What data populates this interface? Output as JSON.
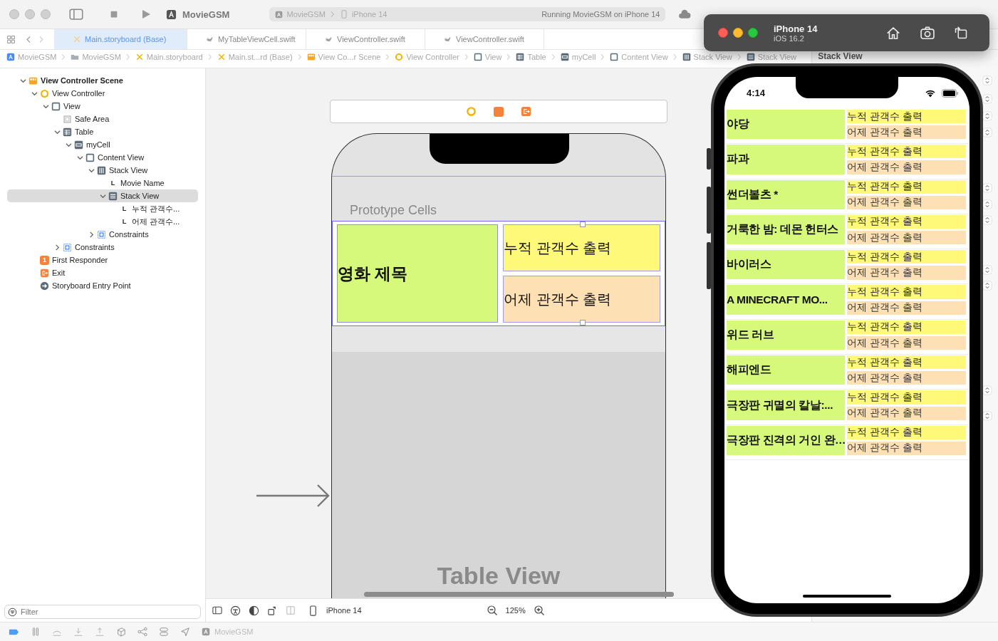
{
  "toolbar": {
    "app": "MovieGSM",
    "scheme": "MovieGSM",
    "device": "iPhone 14",
    "status": "Running MovieGSM on iPhone 14"
  },
  "tabs": [
    {
      "label": "Main.storyboard (Base)",
      "kind": "storyboard",
      "selected": true
    },
    {
      "label": "MyTableViewCell.swift",
      "kind": "swift",
      "selected": false
    },
    {
      "label": "ViewController.swift",
      "kind": "swift",
      "selected": false
    },
    {
      "label": "ViewController.swift",
      "kind": "swift",
      "selected": false
    }
  ],
  "breadcrumb": [
    {
      "label": "MovieGSM",
      "kind": "project"
    },
    {
      "label": "MovieGSM",
      "kind": "folder"
    },
    {
      "label": "Main.storyboard",
      "kind": "storyboard"
    },
    {
      "label": "Main.st...rd (Base)",
      "kind": "storyboard"
    },
    {
      "label": "View Co...r Scene",
      "kind": "scene"
    },
    {
      "label": "View Controller",
      "kind": "controller"
    },
    {
      "label": "View",
      "kind": "view"
    },
    {
      "label": "Table",
      "kind": "table"
    },
    {
      "label": "myCell",
      "kind": "cell"
    },
    {
      "label": "Content View",
      "kind": "view"
    },
    {
      "label": "Stack View",
      "kind": "stack-h"
    },
    {
      "label": "Stack View",
      "kind": "stack-v"
    }
  ],
  "navigator": {
    "filter_placeholder": "Filter",
    "tree": [
      {
        "label": "View Controller Scene",
        "kind": "scene",
        "expanded": true,
        "selected": false,
        "children": [
          {
            "label": "View Controller",
            "kind": "controller",
            "expanded": true,
            "selected": false,
            "children": [
              {
                "label": "View",
                "kind": "view",
                "expanded": true,
                "selected": false,
                "children": [
                  {
                    "label": "Safe Area",
                    "kind": "safe-area",
                    "selected": false
                  },
                  {
                    "label": "Table",
                    "kind": "table",
                    "expanded": true,
                    "selected": false,
                    "children": [
                      {
                        "label": "myCell",
                        "kind": "cell",
                        "expanded": true,
                        "selected": false,
                        "children": [
                          {
                            "label": "Content View",
                            "kind": "view",
                            "expanded": true,
                            "selected": false,
                            "children": [
                              {
                                "label": "Stack View",
                                "kind": "stack-h",
                                "expanded": true,
                                "selected": false,
                                "children": [
                                  {
                                    "label": "Movie Name",
                                    "kind": "label",
                                    "glyph": "L",
                                    "selected": false
                                  },
                                  {
                                    "label": "Stack View",
                                    "kind": "stack-v",
                                    "expanded": true,
                                    "selected": true,
                                    "children": [
                                      {
                                        "label": "누적 관객수...",
                                        "kind": "label",
                                        "glyph": "L",
                                        "selected": false
                                      },
                                      {
                                        "label": "어제 관객수...",
                                        "kind": "label",
                                        "glyph": "L",
                                        "selected": false
                                      }
                                    ]
                                  }
                                ]
                              },
                              {
                                "label": "Constraints",
                                "kind": "constraints",
                                "expanded": false,
                                "selected": false
                              }
                            ]
                          }
                        ]
                      }
                    ]
                  },
                  {
                    "label": "Constraints",
                    "kind": "constraints",
                    "expanded": false,
                    "selected": false
                  }
                ]
              }
            ]
          },
          {
            "label": "First Responder",
            "kind": "responder",
            "glyph": "1",
            "selected": false
          },
          {
            "label": "Exit",
            "kind": "exit",
            "selected": false
          },
          {
            "label": "Storyboard Entry Point",
            "kind": "entry",
            "selected": false
          }
        ]
      }
    ]
  },
  "canvas": {
    "header": "Prototype Cells",
    "cell": {
      "title": "영화 제목",
      "total": "누적 관객수 출력",
      "yesterday": "어제 관객수 출력"
    },
    "table_label": "Table View",
    "device": "iPhone 14",
    "zoom": "125%"
  },
  "debug_bar": {
    "target": "MovieGSM"
  },
  "inspector": {
    "title": "Stack View"
  },
  "simulator": {
    "device": "iPhone 14",
    "os": "iOS 16.2",
    "time": "4:14",
    "rows": [
      {
        "title": "야당",
        "total": "누적 관객수 출력",
        "yesterday": "어제 관객수 출력"
      },
      {
        "title": "파과",
        "total": "누적 관객수 출력",
        "yesterday": "어제 관객수 출력"
      },
      {
        "title": "썬더볼츠 *",
        "total": "누적 관객수 출력",
        "yesterday": "어제 관객수 출력"
      },
      {
        "title": "거룩한 밤: 데몬 헌터스",
        "total": "누적 관객수 출력",
        "yesterday": "어제 관객수 출력"
      },
      {
        "title": "바이러스",
        "total": "누적 관객수 출력",
        "yesterday": "어제 관객수 출력"
      },
      {
        "title": "A MINECRAFT MO...",
        "total": "누적 관객수 출력",
        "yesterday": "어제 관객수 출력"
      },
      {
        "title": "위드 러브",
        "total": "누적 관객수 출력",
        "yesterday": "어제 관객수 출력"
      },
      {
        "title": "해피엔드",
        "total": "누적 관객수 출력",
        "yesterday": "어제 관객수 출력"
      },
      {
        "title": "극장판 귀멸의 칼날:...",
        "total": "누적 관객수 출력",
        "yesterday": "어제 관객수 출력"
      },
      {
        "title": "극장판 진격의 거인 완…",
        "total": "누적 관객수 출력",
        "yesterday": "어제 관객수 출력"
      }
    ]
  }
}
